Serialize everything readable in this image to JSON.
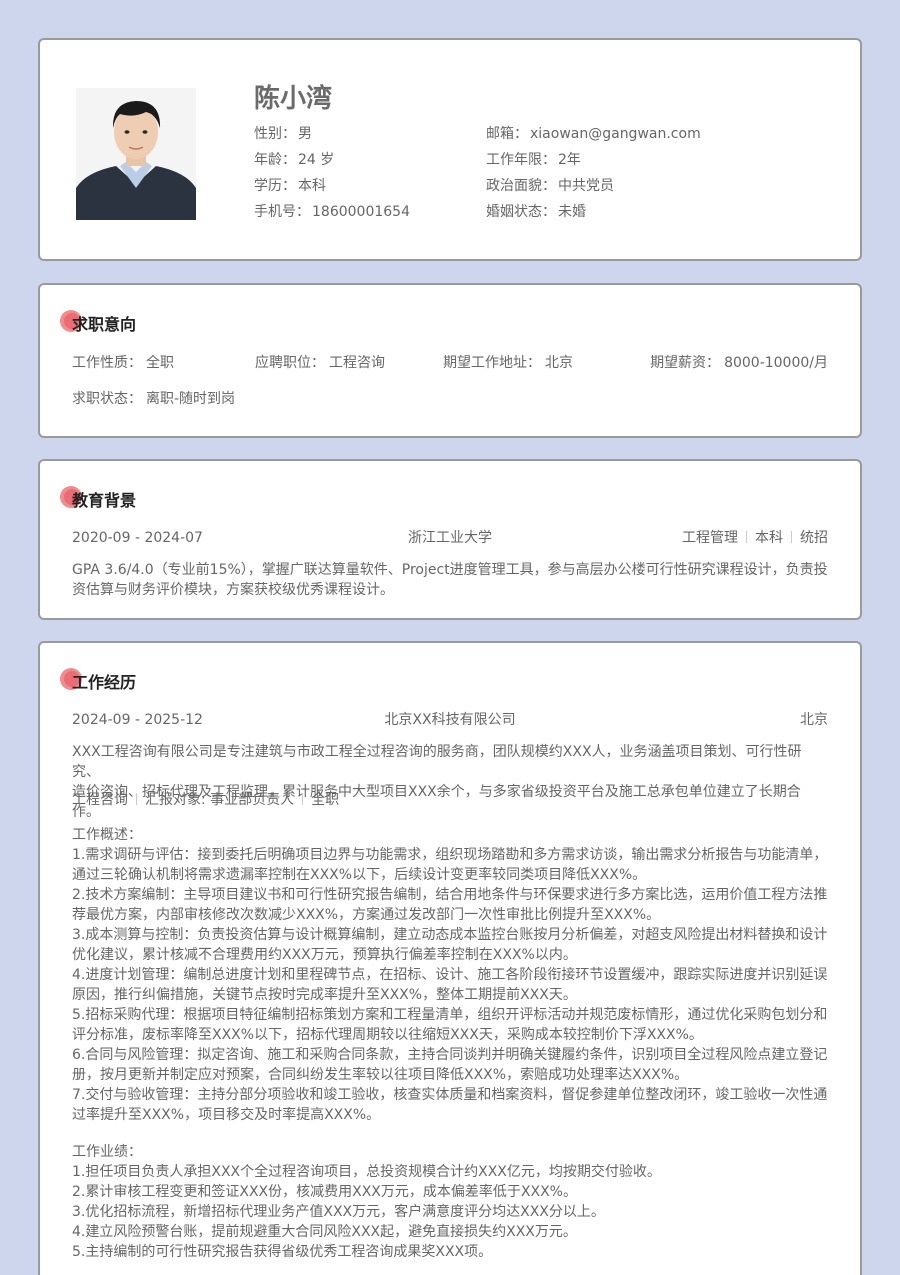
{
  "profile": {
    "name": "陈小湾",
    "fields": [
      {
        "label": "性别：",
        "value": "男"
      },
      {
        "label": "邮箱：",
        "value": "xiaowan@gangwan.com"
      },
      {
        "label": "年龄：",
        "value": "24 岁"
      },
      {
        "label": "工作年限：",
        "value": "2年"
      },
      {
        "label": "学历：",
        "value": "本科"
      },
      {
        "label": "政治面貌：",
        "value": "中共党员"
      },
      {
        "label": "手机号：",
        "value": "18600001654"
      },
      {
        "label": "婚姻状态：",
        "value": "未婚"
      }
    ]
  },
  "intent": {
    "title": "求职意向",
    "items": [
      {
        "label": "工作性质：",
        "value": "全职"
      },
      {
        "label": "应聘职位：",
        "value": "工程咨询"
      },
      {
        "label": "期望工作地址：",
        "value": "北京"
      },
      {
        "label": "期望薪资：",
        "value": "8000-10000/月"
      },
      {
        "label": "求职状态：",
        "value": "离职-随时到岗"
      }
    ]
  },
  "education": {
    "title": "教育背景",
    "period": "2020-09 - 2024-07",
    "school": "浙江工业大学",
    "major": "工程管理",
    "degree": "本科",
    "type": "统招",
    "desc_line1": "GPA 3.6/4.0（专业前15%），掌握广联达算量软件、Project进度管理工具，参与高层办公楼可行性研究课程设计，负责投",
    "desc_line2": "资估算与财务评价模块，方案获校级优秀课程设计。"
  },
  "work": {
    "title": "工作经历",
    "period": "2024-09 - 2025-12",
    "company": "北京XX科技有限公司",
    "city": "北京",
    "intro_line1": "XXX工程咨询有限公司是专注建筑与市政工程全过程咨询的服务商，团队规模约XXX人，业务涵盖项目策划、可行性研究、",
    "intro_line2": "造价咨询、招标代理及工程监理，累计服务中大型项目XXX余个，与多家省级投资平台及施工总承包单位建立了长期合作。",
    "tag1": "工程咨询",
    "tag2": "汇报对象: 事业部负责人",
    "tag3": "全职",
    "overview_title": "工作概述：",
    "overview": [
      "1.需求调研与评估：接到委托后明确项目边界与功能需求，组织现场踏勘和多方需求访谈，输出需求分析报告与功能清单，",
      "通过三轮确认机制将需求遗漏率控制在XXX%以下，后续设计变更率较同类项目降低XXX%。",
      "2.技术方案编制：主导项目建议书和可行性研究报告编制，结合用地条件与环保要求进行多方案比选，运用价值工程方法推",
      "荐最优方案，内部审核修改次数减少XXX%，方案通过发改部门一次性审批比例提升至XXX%。",
      "3.成本测算与控制：负责投资估算与设计概算编制，建立动态成本监控台账按月分析偏差，对超支风险提出材料替换和设计",
      "优化建议，累计核减不合理费用约XXX万元，预算执行偏差率控制在XXX%以内。",
      "4.进度计划管理：编制总进度计划和里程碑节点，在招标、设计、施工各阶段衔接环节设置缓冲，跟踪实际进度并识别延误",
      "原因，推行纠偏措施，关键节点按时完成率提升至XXX%，整体工期提前XXX天。",
      "5.招标采购代理：根据项目特征编制招标策划方案和工程量清单，组织开评标活动并规范废标情形，通过优化采购包划分和",
      "评分标准，废标率降至XXX%以下，招标代理周期较以往缩短XXX天，采购成本较控制价下浮XXX%。",
      "6.合同与风险管理：拟定咨询、施工和采购合同条款，主持合同谈判并明确关键履约条件，识别项目全过程风险点建立登记",
      "册，按月更新并制定应对预案，合同纠纷发生率较以往项目降低XXX%，索赔成功处理率达XXX%。",
      "7.交付与验收管理：主持分部分项验收和竣工验收，核查实体质量和档案资料，督促参建单位整改闭环，竣工验收一次性通",
      "过率提升至XXX%，项目移交及时率提高XXX%。"
    ],
    "achieve_title": "工作业绩：",
    "achievements": [
      "1.担任项目负责人承担XXX个全过程咨询项目，总投资规模合计约XXX亿元，均按期交付验收。",
      "2.累计审核工程变更和签证XXX份，核减费用XXX万元，成本偏差率低于XXX%。",
      "3.优化招标流程，新增招标代理业务产值XXX万元，客户满意度评分均达XXX分以上。",
      "4.建立风险预警台账，提前规避重大合同风险XXX起，避免直接损失约XXX万元。",
      "5.主持编制的可行性研究报告获得省级优秀工程咨询成果奖XXX项。"
    ]
  }
}
